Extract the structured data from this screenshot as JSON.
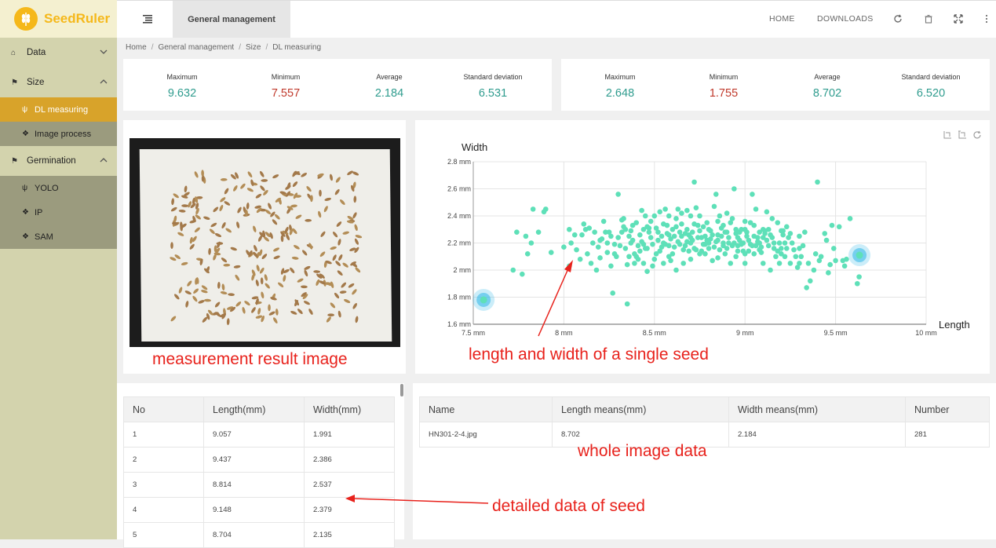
{
  "app": {
    "name": "SeedRuler"
  },
  "sidebar": {
    "items": [
      {
        "label": "Data",
        "icon": "home-icon"
      },
      {
        "label": "Size",
        "icon": "flag-icon"
      },
      {
        "label": "Germination",
        "icon": "flag-icon"
      }
    ],
    "size_sub": [
      {
        "label": "DL measuring",
        "icon": "seedling-icon"
      },
      {
        "label": "Image process",
        "icon": "tag-icon"
      }
    ],
    "germ_sub": [
      {
        "label": "YOLO",
        "icon": "seedling-icon"
      },
      {
        "label": "IP",
        "icon": "tag-icon"
      },
      {
        "label": "SAM",
        "icon": "tag-icon"
      }
    ]
  },
  "header": {
    "tab": "General management",
    "home": "HOME",
    "downloads": "DOWNLOADS"
  },
  "breadcrumb": [
    "Home",
    "General management",
    "Size",
    "DL measuring"
  ],
  "stats": {
    "length": [
      {
        "label": "Maximum",
        "value": "9.632"
      },
      {
        "label": "Minimum",
        "value": "7.557"
      },
      {
        "label": "Average",
        "value": "2.184"
      },
      {
        "label": "Standard deviation",
        "value": "6.531"
      }
    ],
    "width": [
      {
        "label": "Maximum",
        "value": "2.648"
      },
      {
        "label": "Minimum",
        "value": "1.755"
      },
      {
        "label": "Average",
        "value": "8.702"
      },
      {
        "label": "Standard deviation",
        "value": "6.520"
      }
    ]
  },
  "annotations": {
    "image": "measurement result image",
    "scatter": "length and width of a single seed",
    "whole": "whole image data",
    "detail": "detailed data of seed"
  },
  "detail_table": {
    "headers": [
      "No",
      "Length(mm)",
      "Width(mm)"
    ],
    "rows": [
      [
        "1",
        "9.057",
        "1.991"
      ],
      [
        "2",
        "9.437",
        "2.386"
      ],
      [
        "3",
        "8.814",
        "2.537"
      ],
      [
        "4",
        "9.148",
        "2.379"
      ],
      [
        "5",
        "8.704",
        "2.135"
      ]
    ]
  },
  "whole_table": {
    "headers": [
      "Name",
      "Length means(mm)",
      "Width means(mm)",
      "Number"
    ],
    "rows": [
      [
        "HN301-2-4.jpg",
        "8.702",
        "2.184",
        "281"
      ]
    ]
  },
  "colors": {
    "accent": "#d8a32a",
    "teal": "#2f9c8e",
    "red": "#c0392b",
    "point": "#5ee0b8"
  },
  "chart_data": {
    "type": "scatter",
    "xlabel": "Length",
    "ylabel": "Width",
    "xlim": [
      7.5,
      10
    ],
    "ylim": [
      1.6,
      2.8
    ],
    "xticks": [
      "7.5 mm",
      "8 mm",
      "8.5 mm",
      "9 mm",
      "9.5 mm",
      "10 mm"
    ],
    "yticks": [
      "1.6 mm",
      "1.8 mm",
      "2 mm",
      "2.2 mm",
      "2.4 mm",
      "2.6 mm",
      "2.8 mm"
    ],
    "highlighted": [
      [
        7.557,
        1.78
      ],
      [
        9.632,
        2.11
      ]
    ],
    "points": [
      [
        7.72,
        2.0
      ],
      [
        7.74,
        2.28
      ],
      [
        7.82,
        2.2
      ],
      [
        7.83,
        2.45
      ],
      [
        7.86,
        2.28
      ],
      [
        7.89,
        2.43
      ],
      [
        7.9,
        2.45
      ],
      [
        7.79,
        2.25
      ],
      [
        7.8,
        2.12
      ],
      [
        7.77,
        1.97
      ],
      [
        7.93,
        2.13
      ],
      [
        8.0,
        2.17
      ],
      [
        8.03,
        2.03
      ],
      [
        8.07,
        2.15
      ],
      [
        8.1,
        2.26
      ],
      [
        8.12,
        2.3
      ],
      [
        8.16,
        2.2
      ],
      [
        8.2,
        2.09
      ],
      [
        8.22,
        2.36
      ],
      [
        8.24,
        2.13
      ],
      [
        8.26,
        2.03
      ],
      [
        8.27,
        1.83
      ],
      [
        8.3,
        2.56
      ],
      [
        8.32,
        2.28
      ],
      [
        8.33,
        2.32
      ],
      [
        8.35,
        1.75
      ],
      [
        8.37,
        2.2
      ],
      [
        8.4,
        2.1
      ],
      [
        8.42,
        2.26
      ],
      [
        8.44,
        2.3
      ],
      [
        8.46,
        1.99
      ],
      [
        8.48,
        2.36
      ],
      [
        8.5,
        2.4
      ],
      [
        8.52,
        2.22
      ],
      [
        8.54,
        2.25
      ],
      [
        8.56,
        2.45
      ],
      [
        8.58,
        2.1
      ],
      [
        8.6,
        2.3
      ],
      [
        8.62,
        2.38
      ],
      [
        8.64,
        2.28
      ],
      [
        8.66,
        2.05
      ],
      [
        8.68,
        2.44
      ],
      [
        8.7,
        2.2
      ],
      [
        8.72,
        2.65
      ],
      [
        8.74,
        2.33
      ],
      [
        8.76,
        2.14
      ],
      [
        8.78,
        2.25
      ],
      [
        8.8,
        2.3
      ],
      [
        8.82,
        2.07
      ],
      [
        8.84,
        2.56
      ],
      [
        8.86,
        2.4
      ],
      [
        8.88,
        2.2
      ],
      [
        8.9,
        2.28
      ],
      [
        8.92,
        2.35
      ],
      [
        8.94,
        2.6
      ],
      [
        8.96,
        2.18
      ],
      [
        8.98,
        2.3
      ],
      [
        9.0,
        2.05
      ],
      [
        9.02,
        2.22
      ],
      [
        9.04,
        2.56
      ],
      [
        9.06,
        2.45
      ],
      [
        9.08,
        2.15
      ],
      [
        9.1,
        2.3
      ],
      [
        9.12,
        2.43
      ],
      [
        9.14,
        2.0
      ],
      [
        9.16,
        2.2
      ],
      [
        9.18,
        2.35
      ],
      [
        9.2,
        2.29
      ],
      [
        9.22,
        2.1
      ],
      [
        9.25,
        2.27
      ],
      [
        9.27,
        2.15
      ],
      [
        9.3,
        2.05
      ],
      [
        9.32,
        2.18
      ],
      [
        9.34,
        1.87
      ],
      [
        9.36,
        1.92
      ],
      [
        9.38,
        2.0
      ],
      [
        9.4,
        2.65
      ],
      [
        9.42,
        2.1
      ],
      [
        9.45,
        2.22
      ],
      [
        9.47,
        2.04
      ],
      [
        9.5,
        2.07
      ],
      [
        9.52,
        2.32
      ],
      [
        9.55,
        2.03
      ],
      [
        9.58,
        2.38
      ],
      [
        9.63,
        1.95
      ],
      [
        9.62,
        1.9
      ],
      [
        8.36,
        2.25
      ],
      [
        8.38,
        2.33
      ],
      [
        8.39,
        2.12
      ],
      [
        8.41,
        2.18
      ],
      [
        8.43,
        2.21
      ],
      [
        8.45,
        2.16
      ],
      [
        8.47,
        2.28
      ],
      [
        8.49,
        2.19
      ],
      [
        8.51,
        2.31
      ],
      [
        8.53,
        2.14
      ],
      [
        8.55,
        2.2
      ],
      [
        8.57,
        2.27
      ],
      [
        8.59,
        2.23
      ],
      [
        8.61,
        2.17
      ],
      [
        8.63,
        2.21
      ],
      [
        8.65,
        2.34
      ],
      [
        8.67,
        2.18
      ],
      [
        8.69,
        2.26
      ],
      [
        8.71,
        2.22
      ],
      [
        8.73,
        2.15
      ],
      [
        8.75,
        2.29
      ],
      [
        8.77,
        2.19
      ],
      [
        8.79,
        2.35
      ],
      [
        8.81,
        2.23
      ],
      [
        8.83,
        2.17
      ],
      [
        8.85,
        2.26
      ],
      [
        8.87,
        2.31
      ],
      [
        8.89,
        2.12
      ],
      [
        8.91,
        2.24
      ],
      [
        8.93,
        2.18
      ],
      [
        8.95,
        2.27
      ],
      [
        8.97,
        2.22
      ],
      [
        8.99,
        2.14
      ],
      [
        9.01,
        2.28
      ],
      [
        9.03,
        2.19
      ],
      [
        9.05,
        2.25
      ],
      [
        9.07,
        2.21
      ],
      [
        9.09,
        2.13
      ],
      [
        9.11,
        2.27
      ],
      [
        9.13,
        2.18
      ],
      [
        9.15,
        2.24
      ],
      [
        9.17,
        2.1
      ],
      [
        9.19,
        2.2
      ],
      [
        9.21,
        2.26
      ],
      [
        9.23,
        2.16
      ],
      [
        8.2,
        2.22
      ],
      [
        8.25,
        2.28
      ],
      [
        8.28,
        2.12
      ],
      [
        8.31,
        2.18
      ],
      [
        8.34,
        2.3
      ],
      [
        8.4,
        2.35
      ],
      [
        8.44,
        2.05
      ],
      [
        8.5,
        2.08
      ],
      [
        8.55,
        2.34
      ],
      [
        8.6,
        2.12
      ],
      [
        8.65,
        2.42
      ],
      [
        8.7,
        2.08
      ],
      [
        8.75,
        2.4
      ],
      [
        8.8,
        2.16
      ],
      [
        8.85,
        2.09
      ],
      [
        8.9,
        2.42
      ],
      [
        8.95,
        2.1
      ],
      [
        9.0,
        2.36
      ],
      [
        9.05,
        2.12
      ],
      [
        9.1,
        2.05
      ],
      [
        9.15,
        2.38
      ],
      [
        9.2,
        2.12
      ],
      [
        9.25,
        2.05
      ],
      [
        9.3,
        2.25
      ],
      [
        9.35,
        2.05
      ],
      [
        8.15,
        2.05
      ],
      [
        8.13,
        2.12
      ],
      [
        8.18,
        2.0
      ],
      [
        8.23,
        2.28
      ],
      [
        8.35,
        2.04
      ],
      [
        8.46,
        2.16
      ],
      [
        8.62,
        2.0
      ],
      [
        8.78,
        2.12
      ],
      [
        8.92,
        2.05
      ],
      [
        9.08,
        2.28
      ],
      [
        9.28,
        2.1
      ],
      [
        8.3,
        2.24
      ],
      [
        8.42,
        2.14
      ],
      [
        8.52,
        2.28
      ],
      [
        8.58,
        2.18
      ],
      [
        8.68,
        2.3
      ],
      [
        8.72,
        2.16
      ],
      [
        8.82,
        2.26
      ],
      [
        8.88,
        2.33
      ],
      [
        8.96,
        2.24
      ],
      [
        9.02,
        2.14
      ],
      [
        9.12,
        2.22
      ],
      [
        9.22,
        2.2
      ],
      [
        8.45,
        2.4
      ],
      [
        8.58,
        2.4
      ],
      [
        8.7,
        2.4
      ],
      [
        8.85,
        2.36
      ],
      [
        9.0,
        2.3
      ],
      [
        9.1,
        2.24
      ],
      [
        9.2,
        2.16
      ],
      [
        9.3,
        2.16
      ],
      [
        8.55,
        2.05
      ],
      [
        8.7,
        2.24
      ],
      [
        8.8,
        2.2
      ],
      [
        8.9,
        2.16
      ],
      [
        9.0,
        2.12
      ],
      [
        8.65,
        2.25
      ],
      [
        8.75,
        2.12
      ],
      [
        8.85,
        2.22
      ],
      [
        8.95,
        2.3
      ],
      [
        9.05,
        2.33
      ],
      [
        8.09,
        2.08
      ],
      [
        8.19,
        2.17
      ],
      [
        8.29,
        2.1
      ],
      [
        8.39,
        2.05
      ],
      [
        8.49,
        2.03
      ],
      [
        8.59,
        2.07
      ],
      [
        8.69,
        2.14
      ],
      [
        8.79,
        2.22
      ],
      [
        8.89,
        2.28
      ],
      [
        8.99,
        2.2
      ],
      [
        9.09,
        2.17
      ],
      [
        9.19,
        2.05
      ],
      [
        9.29,
        2.02
      ],
      [
        9.39,
        2.12
      ],
      [
        9.49,
        2.16
      ],
      [
        8.33,
        2.38
      ],
      [
        8.43,
        2.44
      ],
      [
        8.53,
        2.43
      ],
      [
        8.63,
        2.45
      ],
      [
        8.73,
        2.46
      ],
      [
        8.83,
        2.47
      ],
      [
        8.93,
        2.38
      ],
      [
        9.03,
        2.35
      ],
      [
        9.13,
        2.3
      ],
      [
        9.23,
        2.32
      ],
      [
        8.28,
        2.19
      ],
      [
        8.38,
        2.22
      ],
      [
        8.48,
        2.24
      ],
      [
        8.58,
        2.26
      ],
      [
        8.68,
        2.21
      ],
      [
        8.78,
        2.19
      ],
      [
        8.88,
        2.18
      ],
      [
        8.98,
        2.19
      ],
      [
        9.08,
        2.2
      ],
      [
        9.18,
        2.14
      ],
      [
        8.34,
        2.16
      ],
      [
        8.44,
        2.19
      ],
      [
        8.54,
        2.17
      ],
      [
        8.64,
        2.19
      ],
      [
        8.74,
        2.24
      ],
      [
        8.84,
        2.21
      ],
      [
        8.94,
        2.2
      ],
      [
        9.04,
        2.18
      ],
      [
        9.14,
        2.26
      ],
      [
        9.24,
        2.24
      ],
      [
        8.37,
        2.29
      ],
      [
        8.47,
        2.31
      ],
      [
        8.57,
        2.33
      ],
      [
        8.67,
        2.27
      ],
      [
        8.77,
        2.32
      ],
      [
        8.87,
        2.25
      ],
      [
        8.97,
        2.28
      ],
      [
        9.07,
        2.24
      ],
      [
        8.62,
        2.32
      ],
      [
        8.72,
        2.34
      ],
      [
        8.03,
        2.3
      ],
      [
        8.06,
        2.26
      ],
      [
        8.11,
        2.34
      ],
      [
        8.14,
        2.31
      ],
      [
        8.17,
        2.28
      ],
      [
        8.21,
        2.23
      ],
      [
        8.24,
        2.2
      ],
      [
        8.26,
        2.25
      ],
      [
        8.32,
        2.37
      ],
      [
        8.36,
        2.1
      ],
      [
        8.41,
        2.08
      ],
      [
        8.46,
        2.32
      ],
      [
        8.51,
        2.12
      ],
      [
        8.56,
        2.19
      ],
      [
        8.61,
        2.25
      ],
      [
        8.66,
        2.15
      ],
      [
        8.71,
        2.28
      ],
      [
        8.76,
        2.24
      ],
      [
        8.81,
        2.29
      ],
      [
        8.86,
        2.15
      ],
      [
        8.91,
        2.2
      ],
      [
        8.96,
        2.14
      ],
      [
        9.01,
        2.25
      ],
      [
        9.06,
        2.18
      ],
      [
        9.11,
        2.29
      ],
      [
        9.16,
        2.16
      ],
      [
        9.21,
        2.29
      ],
      [
        9.26,
        2.2
      ],
      [
        9.31,
        2.1
      ],
      [
        9.33,
        2.28
      ],
      [
        9.41,
        2.07
      ],
      [
        9.44,
        2.27
      ],
      [
        9.48,
        2.33
      ],
      [
        9.54,
        2.07
      ],
      [
        9.56,
        2.08
      ],
      [
        8.04,
        2.2
      ],
      [
        9.46,
        1.98
      ]
    ]
  }
}
